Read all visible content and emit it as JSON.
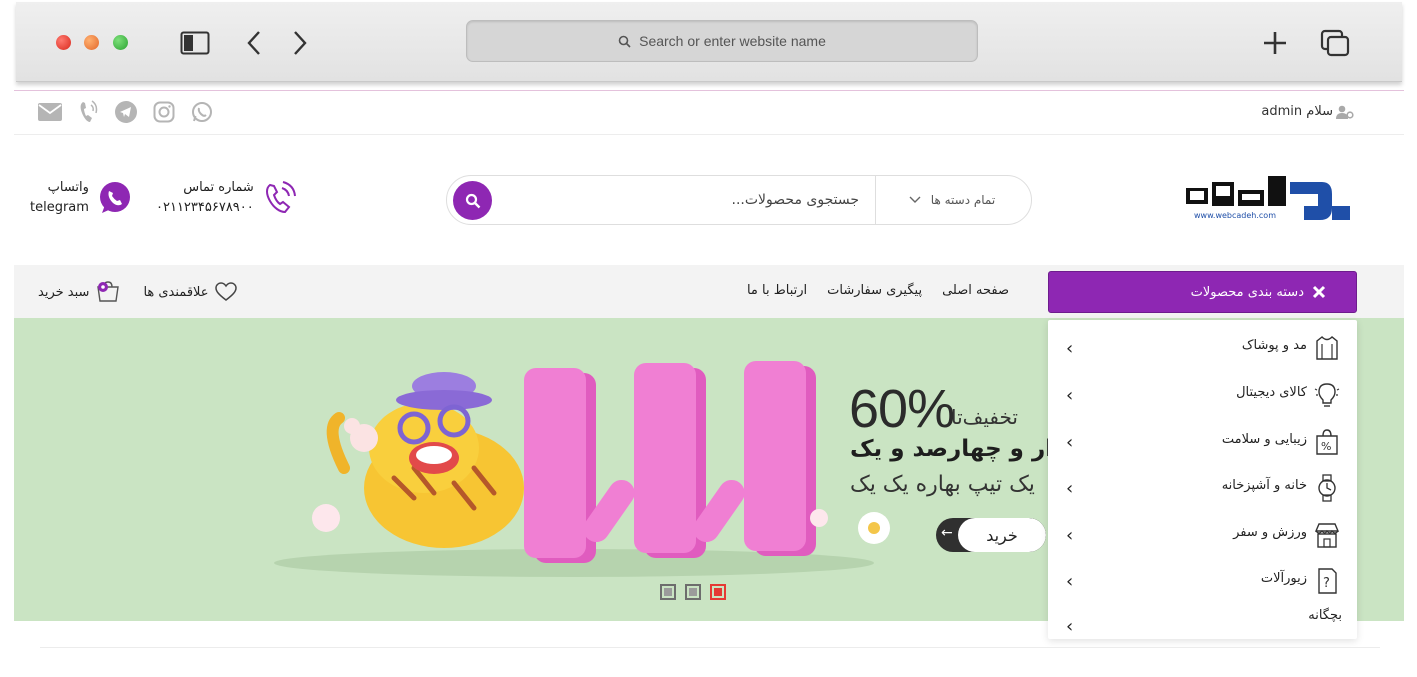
{
  "browser": {
    "url_placeholder": "Search or enter website name"
  },
  "topbar": {
    "greeting": "سلام admin",
    "social_icons": [
      "mail-icon",
      "phone-icon",
      "telegram-icon",
      "instagram-icon",
      "whatsapp-icon"
    ]
  },
  "header": {
    "logo_text": "وبکده",
    "logo_url": "www.webcadeh.com",
    "search_placeholder": "جستجوی محصولات...",
    "category_select": "تمام دسته ها",
    "phone_label": "شماره تماس",
    "phone_number": "۰۲۱۱۲۳۴۵۶۷۸۹۰۰",
    "whatsapp_label": "واتساپ",
    "telegram_label": "telegram"
  },
  "nav": {
    "categories_button": "دسته بندی محصولات",
    "links": [
      "صفحه اصلی",
      "پیگیری سفارشات",
      "ارتباط با ما"
    ],
    "wishlist": "علاقمندی ها",
    "cart": "سبد خرید"
  },
  "banner": {
    "percent": "60%",
    "discount_label": "تخفیف‌تا",
    "headline": "هزار و چهارصد و یک",
    "subline": "یک تیپ بهاره یک یک",
    "buy_button": "خرید",
    "slides": 3,
    "active_slide": 3
  },
  "categories": [
    {
      "label": "مد و پوشاک",
      "icon": "shirt-icon"
    },
    {
      "label": "کالای دیجیتال",
      "icon": "lightbulb-icon"
    },
    {
      "label": "زیبایی و سلامت",
      "icon": "percent-bag-icon"
    },
    {
      "label": "خانه و آشپزخانه",
      "icon": "watch-icon"
    },
    {
      "label": "ورزش و سفر",
      "icon": "store-icon"
    },
    {
      "label": "زیورآلات",
      "icon": "question-icon"
    },
    {
      "label": "بچگانه",
      "icon": ""
    }
  ],
  "colors": {
    "brand_purple": "#8e27b3",
    "banner_bg": "#cae4c3",
    "logo_blue": "#1f4fa8"
  }
}
